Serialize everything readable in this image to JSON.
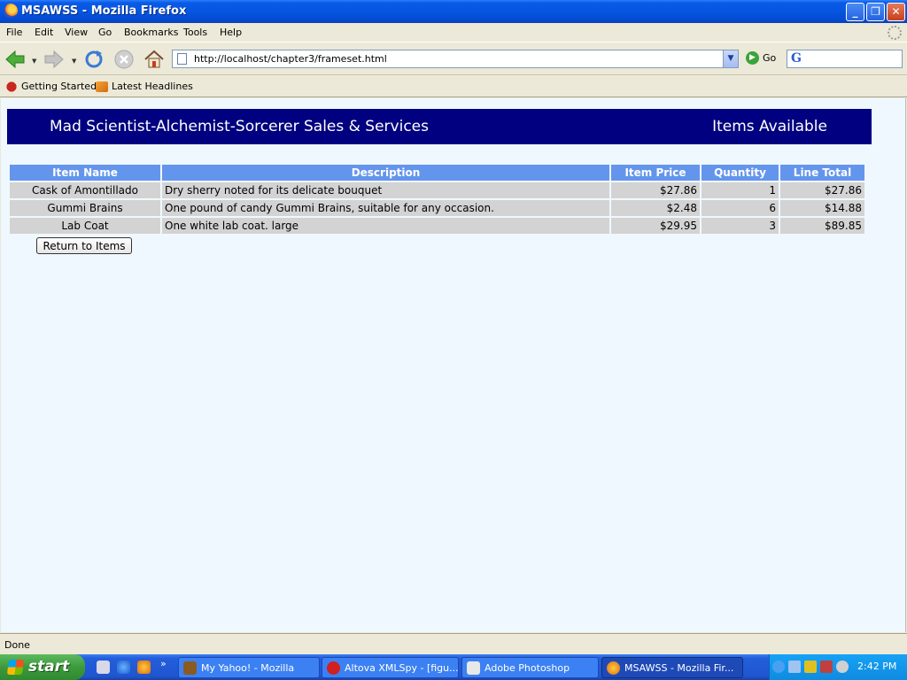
{
  "window": {
    "title": "MSAWSS - Mozilla Firefox"
  },
  "menu": [
    "File",
    "Edit",
    "View",
    "Go",
    "Bookmarks",
    "Tools",
    "Help"
  ],
  "navbar": {
    "url": "http://localhost/chapter3/frameset.html",
    "go_label": "Go"
  },
  "bookmarks": [
    "Getting Started",
    "Latest Headlines"
  ],
  "page": {
    "banner_left": "Mad Scientist-Alchemist-Sorcerer Sales & Services",
    "banner_right": "Items Available",
    "table": {
      "columns": [
        "Item Name",
        "Description",
        "Item Price",
        "Quantity",
        "Line Total"
      ],
      "rows": [
        [
          "Cask of Amontillado",
          "Dry sherry noted for its delicate bouquet",
          "$27.86",
          "1",
          "$27.86"
        ],
        [
          "Gummi Brains",
          "One pound of candy Gummi Brains, suitable for any occasion.",
          "$2.48",
          "6",
          "$14.88"
        ],
        [
          "Lab Coat",
          "One white lab coat. large",
          "$29.95",
          "3",
          "$89.85"
        ]
      ]
    },
    "return_button": "Return to Items"
  },
  "status": "Done",
  "taskbar": {
    "start_label": "start",
    "tasks": [
      "My Yahoo! - Mozilla",
      "Altova XMLSpy - [figu...",
      "Adobe Photoshop",
      "MSAWSS - Mozilla Fir..."
    ],
    "clock": "2:42 PM"
  },
  "colors": {
    "banner": "#000080",
    "table_header": "#6495ed",
    "table_cell": "#d3d3d3",
    "page_bg": "#f0f8ff"
  }
}
